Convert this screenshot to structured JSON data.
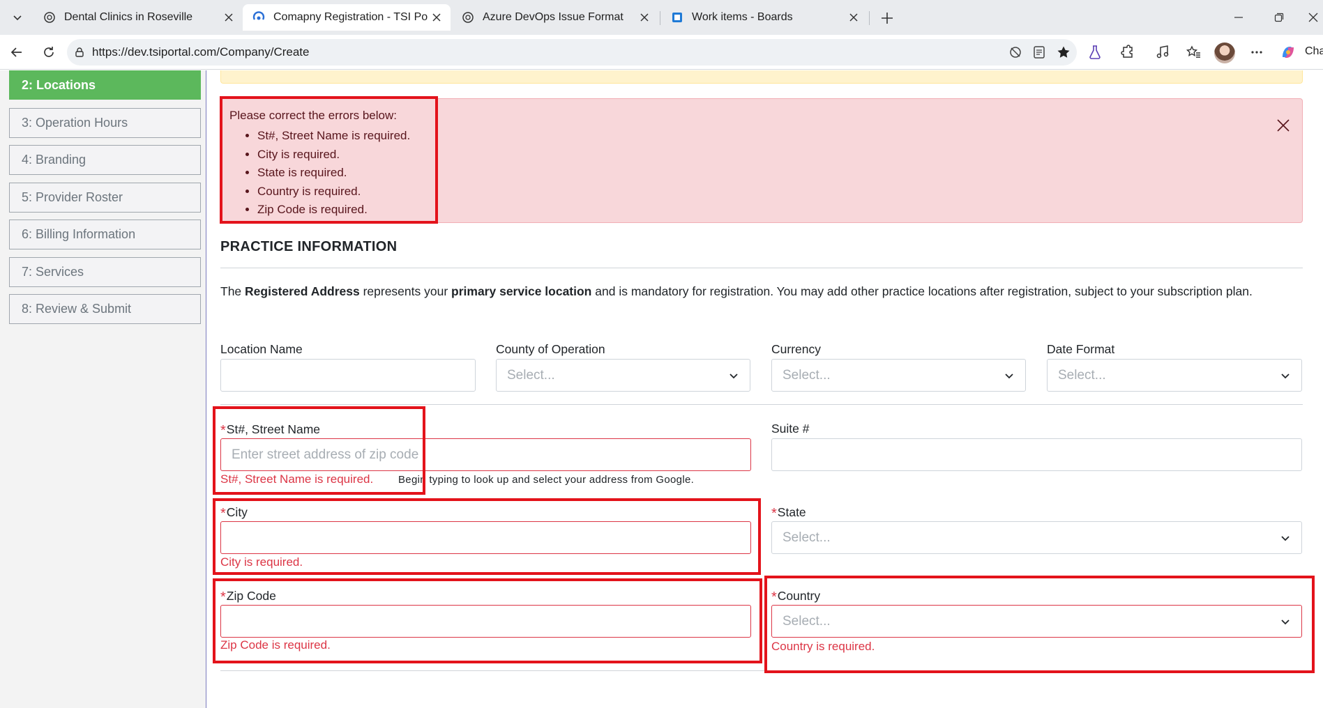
{
  "browser": {
    "tabs": [
      {
        "title": "Dental Clinics in Roseville",
        "icon": "chatgpt-icon",
        "active": false
      },
      {
        "title": "Comapny Registration - TSI Portal",
        "icon": "portal-icon",
        "active": true
      },
      {
        "title": "Azure DevOps Issue Format",
        "icon": "chatgpt-icon",
        "active": false
      },
      {
        "title": "Work items - Boards",
        "icon": "azure-boards-icon",
        "active": false
      }
    ],
    "url": "https://dev.tsiportal.com/Company/Create",
    "copilot_label": "Cha"
  },
  "sidebar": {
    "steps": [
      {
        "label": "2: Locations",
        "active": true
      },
      {
        "label": "3: Operation Hours"
      },
      {
        "label": "4: Branding"
      },
      {
        "label": "5: Provider Roster"
      },
      {
        "label": "6: Billing Information"
      },
      {
        "label": "7: Services"
      },
      {
        "label": "8: Review & Submit"
      }
    ]
  },
  "alert": {
    "heading": "Please correct the errors below:",
    "errors": [
      "St#, Street Name is required.",
      "City is required.",
      "State is required.",
      "Country is required.",
      "Zip Code is required."
    ]
  },
  "section": {
    "title": "PRACTICE INFORMATION",
    "intro": {
      "p1": "The ",
      "b1": "Registered Address",
      "p2": " represents your ",
      "b2": "primary service location",
      "p3": " and is mandatory for registration. You may add other practice locations after registration, subject to your subscription plan."
    }
  },
  "form": {
    "location_name": {
      "label": "Location Name",
      "value": ""
    },
    "county": {
      "label": "County of Operation",
      "value": "Select..."
    },
    "currency": {
      "label": "Currency",
      "value": "Select..."
    },
    "date_format": {
      "label": "Date Format",
      "value": "Select..."
    },
    "street": {
      "label": "St#, Street Name",
      "placeholder": "Enter street address of zip code",
      "error": "St#, Street Name is required.",
      "hint": "Begin typing to look up and select your address from Google."
    },
    "suite": {
      "label": "Suite #",
      "value": ""
    },
    "city": {
      "label": "City",
      "error": "City is required."
    },
    "state": {
      "label": "State",
      "value": "Select..."
    },
    "zip": {
      "label": "Zip Code",
      "error": "Zip Code is required."
    },
    "country": {
      "label": "Country",
      "value": "Select...",
      "error": "Country is required."
    },
    "required_mark": "*"
  },
  "colors": {
    "active_step": "#5cb85c",
    "error": "#dc3545",
    "alert_bg": "#f8d7da",
    "annotation": "#e3131b"
  }
}
